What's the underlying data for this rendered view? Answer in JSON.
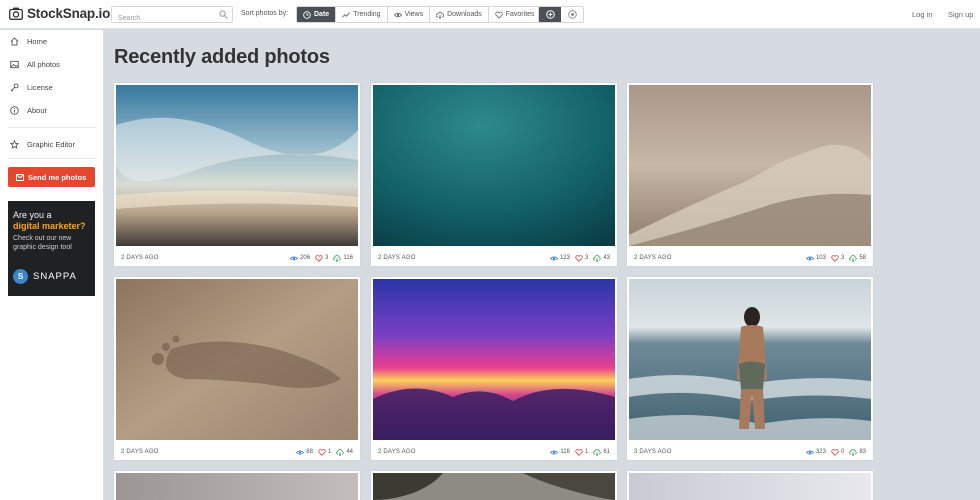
{
  "header": {
    "logo_text": "StockSnap.io",
    "search_placeholder": "Search",
    "sort_label": "Sort photos by:",
    "sort_options": [
      {
        "label": "Date",
        "icon": "clock-icon",
        "active": true
      },
      {
        "label": "Trending",
        "icon": "trending-icon"
      },
      {
        "label": "Views",
        "icon": "eye-icon"
      },
      {
        "label": "Downloads",
        "icon": "download-icon"
      },
      {
        "label": "Favorites",
        "icon": "heart-icon"
      }
    ],
    "login": "Log in",
    "signup": "Sign up"
  },
  "sidebar": {
    "items": [
      {
        "label": "Home",
        "icon": "home-icon"
      },
      {
        "label": "All photos",
        "icon": "image-icon"
      },
      {
        "label": "License",
        "icon": "key-icon"
      },
      {
        "label": "About",
        "icon": "info-icon"
      },
      {
        "label": "Graphic Editor",
        "icon": "star-icon"
      }
    ],
    "send_button": "Send me photos",
    "ad": {
      "line1": "Are you a",
      "line2": "digital marketer?",
      "line3": "Check out our new graphic design tool",
      "brand_letter": "S",
      "brand": "SNAPPA"
    }
  },
  "main": {
    "title": "Recently added photos",
    "photos": [
      {
        "date": "2 DAYS AGO",
        "views": "206",
        "favorites": "3",
        "downloads": "116",
        "scene": "sky-sunset"
      },
      {
        "date": "2 DAYS AGO",
        "views": "123",
        "favorites": "3",
        "downloads": "43",
        "scene": "teal-water"
      },
      {
        "date": "2 DAYS AGO",
        "views": "103",
        "favorites": "3",
        "downloads": "58",
        "scene": "sand-dune"
      },
      {
        "date": "2 DAYS AGO",
        "views": "88",
        "favorites": "1",
        "downloads": "44",
        "scene": "footprint-sand"
      },
      {
        "date": "2 DAYS AGO",
        "views": "116",
        "favorites": "1",
        "downloads": "61",
        "scene": "purple-sunset"
      },
      {
        "date": "3 DAYS AGO",
        "views": "323",
        "favorites": "0",
        "downloads": "83",
        "scene": "woman-ocean"
      },
      {
        "scene": "gray-partial"
      },
      {
        "scene": "trees-partial"
      },
      {
        "scene": "light-partial"
      }
    ]
  },
  "colors": {
    "accent": "#e5462e",
    "active": "#4b4f56",
    "background": "#d6dbe2"
  }
}
